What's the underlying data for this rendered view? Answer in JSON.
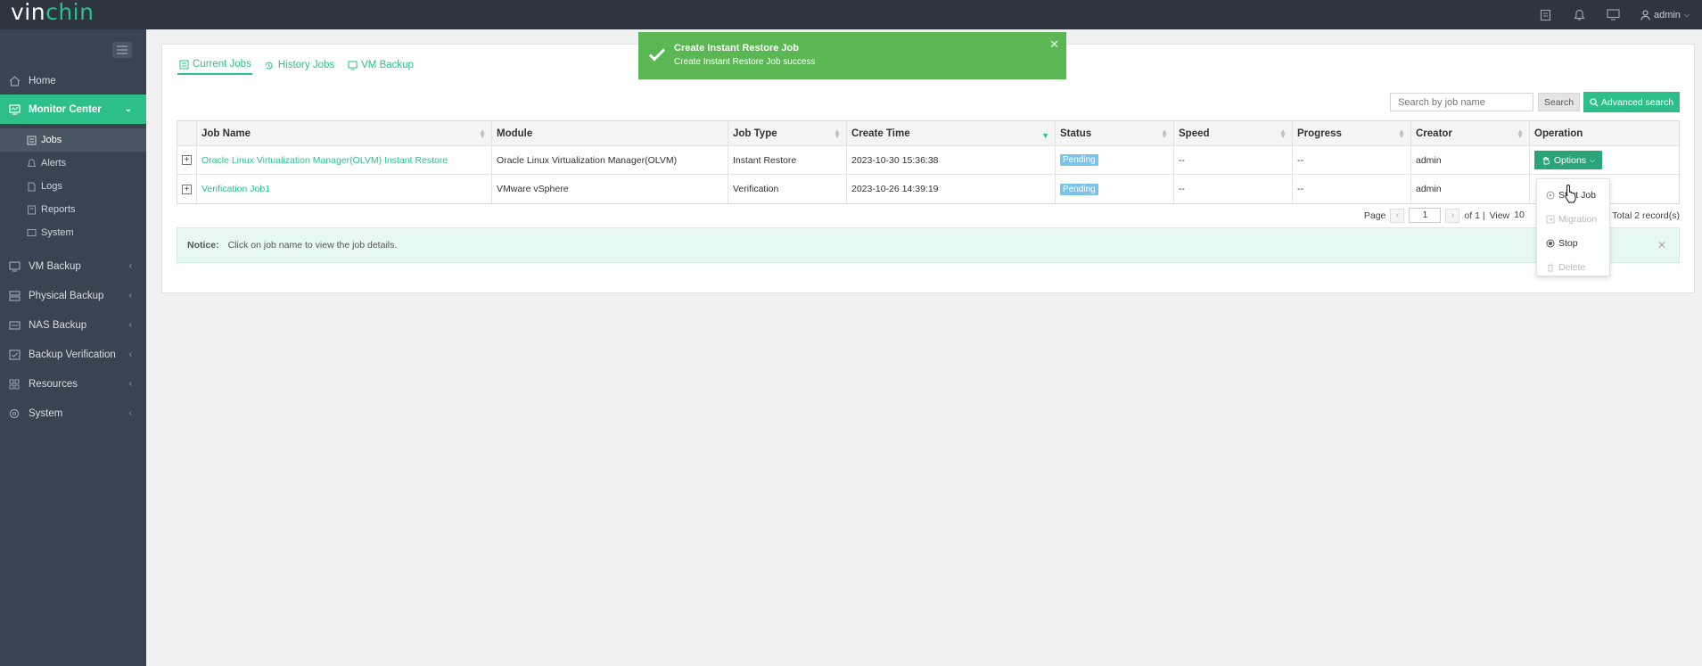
{
  "brand": {
    "logo_prefix": "vin",
    "logo_suffix": "chin",
    "accent": "#2dbf8a"
  },
  "topbar": {
    "user": "admin"
  },
  "sidebar": {
    "items": [
      {
        "label": "Home",
        "icon": "home-icon"
      },
      {
        "label": "Monitor Center",
        "icon": "monitor-icon",
        "active": true
      },
      {
        "label": "VM Backup",
        "icon": "vm-icon"
      },
      {
        "label": "Physical Backup",
        "icon": "server-icon"
      },
      {
        "label": "NAS Backup",
        "icon": "nas-icon"
      },
      {
        "label": "Backup Verification",
        "icon": "verify-icon"
      },
      {
        "label": "Resources",
        "icon": "grid-icon"
      },
      {
        "label": "System",
        "icon": "gear-icon"
      }
    ],
    "sub_items": [
      {
        "label": "Jobs",
        "active": true
      },
      {
        "label": "Alerts"
      },
      {
        "label": "Logs"
      },
      {
        "label": "Reports"
      },
      {
        "label": "System"
      }
    ]
  },
  "tabs": [
    {
      "label": "Current Jobs",
      "active": true
    },
    {
      "label": "History Jobs"
    },
    {
      "label": "VM Backup"
    }
  ],
  "search": {
    "placeholder": "Search by job name",
    "button": "Search",
    "advanced": "Advanced search"
  },
  "table": {
    "headers": [
      "Job Name",
      "Module",
      "Job Type",
      "Create Time",
      "Status",
      "Speed",
      "Progress",
      "Creator",
      "Operation"
    ],
    "rows": [
      {
        "name": "Oracle Linux Virtualization Manager(OLVM) Instant Restore",
        "module": "Oracle Linux Virtualization Manager(OLVM)",
        "type": "Instant Restore",
        "time": "2023-10-30 15:36:38",
        "status": "Pending",
        "speed": "--",
        "progress": "--",
        "creator": "admin",
        "operation": "Options"
      },
      {
        "name": "Verification Job1",
        "module": "VMware vSphere",
        "type": "Verification",
        "time": "2023-10-26 14:39:19",
        "status": "Pending",
        "speed": "--",
        "progress": "--",
        "creator": "admin"
      }
    ]
  },
  "pager": {
    "page_label": "Page",
    "page": "1",
    "of": "of 1 |",
    "view_label": "View",
    "view": "10",
    "total": "Total 2 record(s)"
  },
  "notice": {
    "label": "Notice:",
    "text": "Click on job name to view the job details."
  },
  "dropdown": [
    {
      "label": "Start Job",
      "disabled": false
    },
    {
      "label": "Migration",
      "disabled": true
    },
    {
      "label": "Stop",
      "disabled": false
    },
    {
      "label": "Delete",
      "disabled": true
    }
  ],
  "toast": {
    "title": "Create Instant Restore Job",
    "message": "Create Instant Restore Job success",
    "color": "#5bb754"
  }
}
